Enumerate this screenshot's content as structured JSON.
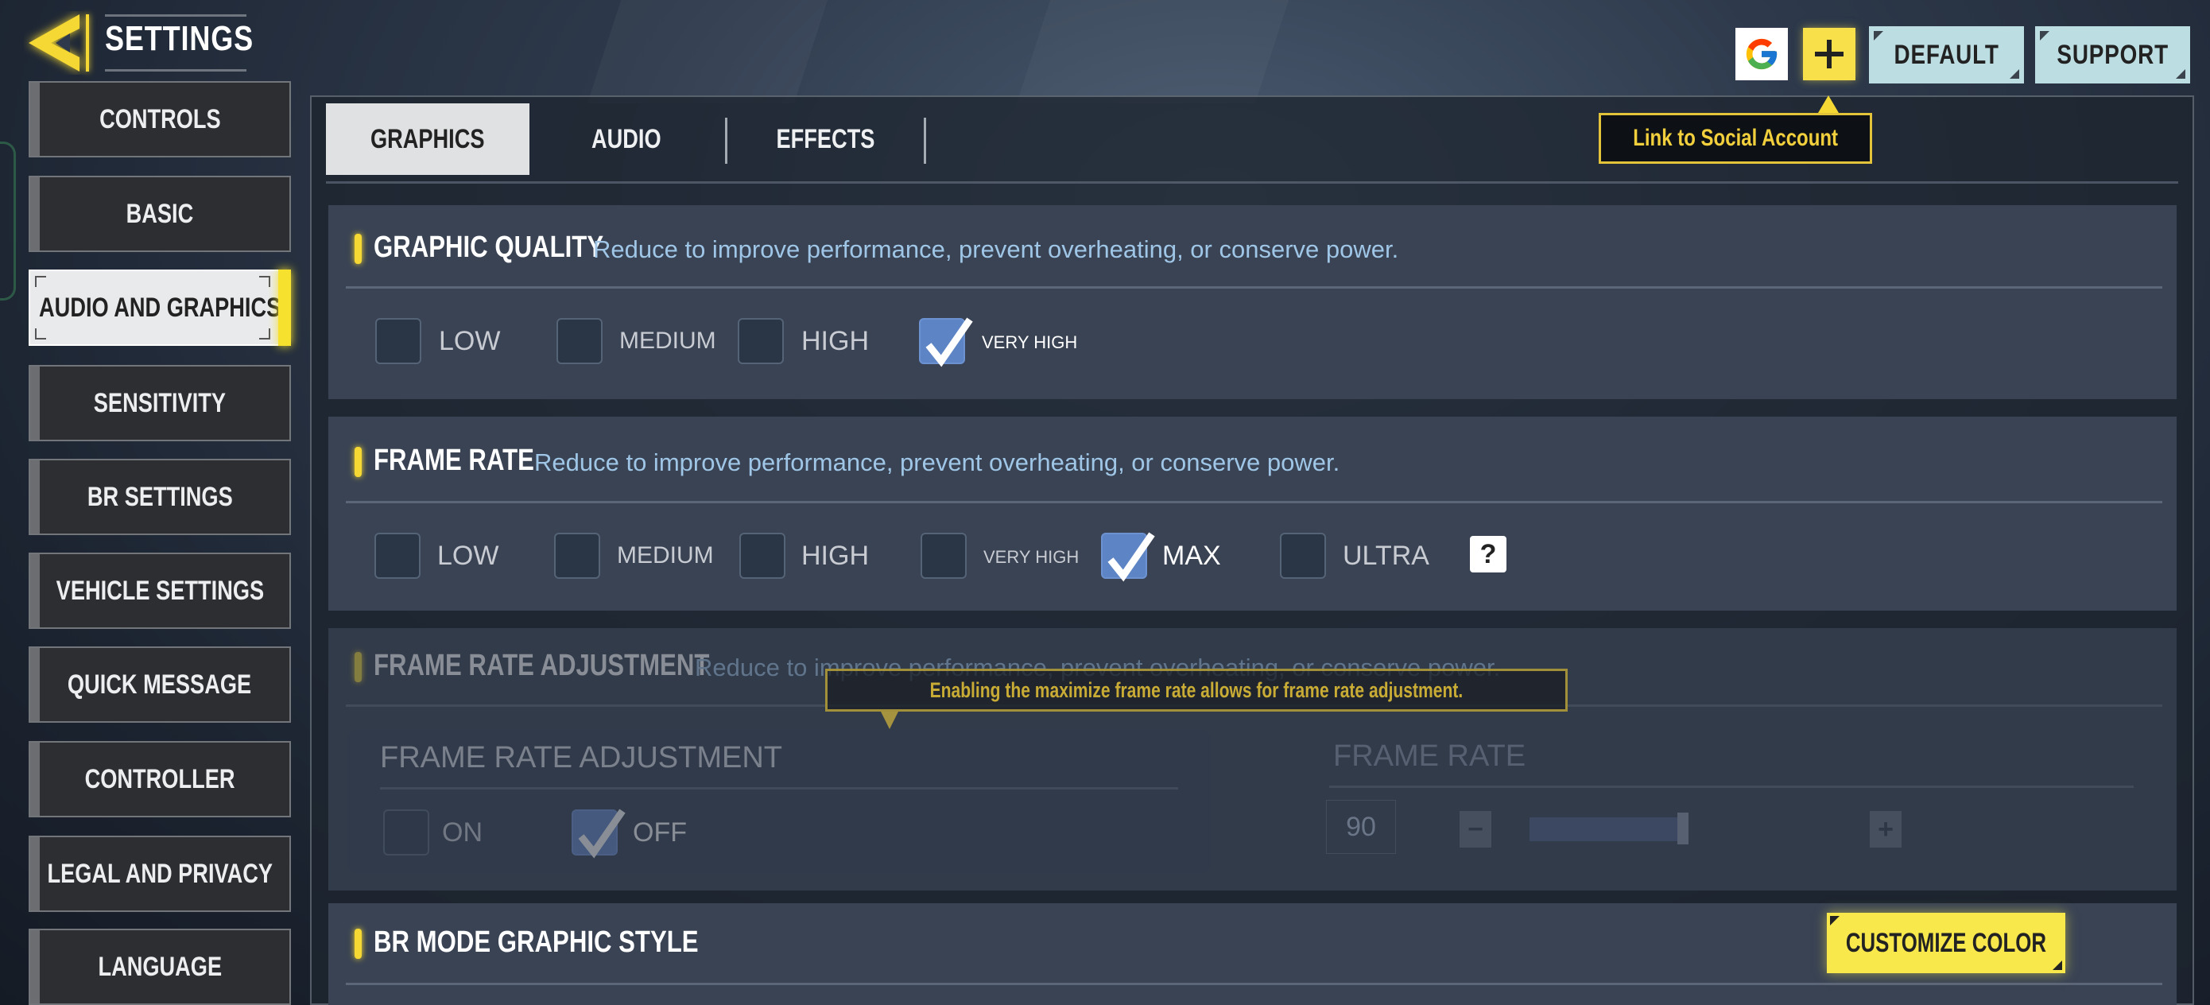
{
  "header": {
    "title": "SETTINGS",
    "back_icon": "back-chevron-icon"
  },
  "top_actions": {
    "google_icon": "google-g-icon",
    "link_icon": "plus-icon",
    "default_label": "DEFAULT",
    "support_label": "SUPPORT",
    "link_tooltip": "Link to Social Account"
  },
  "sidebar": {
    "items": [
      {
        "label": "CONTROLS",
        "active": false
      },
      {
        "label": "BASIC",
        "active": false
      },
      {
        "label": "AUDIO AND GRAPHICS",
        "active": true
      },
      {
        "label": "SENSITIVITY",
        "active": false
      },
      {
        "label": "BR SETTINGS",
        "active": false
      },
      {
        "label": "VEHICLE SETTINGS",
        "active": false
      },
      {
        "label": "QUICK MESSAGE",
        "active": false
      },
      {
        "label": "CONTROLLER",
        "active": false
      },
      {
        "label": "LEGAL AND PRIVACY",
        "active": false
      },
      {
        "label": "LANGUAGE",
        "active": false
      }
    ]
  },
  "tabs": [
    {
      "label": "GRAPHICS",
      "active": true
    },
    {
      "label": "AUDIO",
      "active": false
    },
    {
      "label": "EFFECTS",
      "active": false
    }
  ],
  "graphic_quality": {
    "title": "GRAPHIC QUALITY",
    "description": "Reduce to improve performance, prevent overheating, or conserve power.",
    "options": [
      {
        "label": "LOW",
        "checked": false
      },
      {
        "label": "MEDIUM",
        "checked": false
      },
      {
        "label": "HIGH",
        "checked": false
      },
      {
        "label": "VERY HIGH",
        "checked": true
      }
    ]
  },
  "frame_rate": {
    "title": "FRAME RATE",
    "description": "Reduce to improve performance, prevent overheating, or conserve power.",
    "options": [
      {
        "label": "LOW",
        "checked": false
      },
      {
        "label": "MEDIUM",
        "checked": false
      },
      {
        "label": "HIGH",
        "checked": false
      },
      {
        "label": "VERY HIGH",
        "checked": false
      },
      {
        "label": "MAX",
        "checked": true
      },
      {
        "label": "ULTRA",
        "checked": false
      }
    ],
    "help_label": "?"
  },
  "frame_rate_adjustment": {
    "title": "FRAME RATE ADJUSTMENT",
    "description": "Reduce to improve performance, prevent overheating, or conserve power.",
    "tooltip": "Enabling the maximize frame rate allows for frame rate adjustment.",
    "toggle_title": "FRAME RATE ADJUSTMENT",
    "options": [
      {
        "label": "ON",
        "checked": false
      },
      {
        "label": "OFF",
        "checked": true
      }
    ],
    "rate_title": "FRAME RATE",
    "rate_value": "90",
    "slider_fraction": 0.47,
    "minus_label": "−",
    "plus_label": "+"
  },
  "br_mode": {
    "title": "BR MODE GRAPHIC STYLE",
    "customize_label": "CUSTOMIZE COLOR"
  },
  "colors": {
    "accent_yellow": "#f5d833",
    "checkbox_checked": "#5d84c4",
    "description_blue": "#9fc6e6"
  }
}
